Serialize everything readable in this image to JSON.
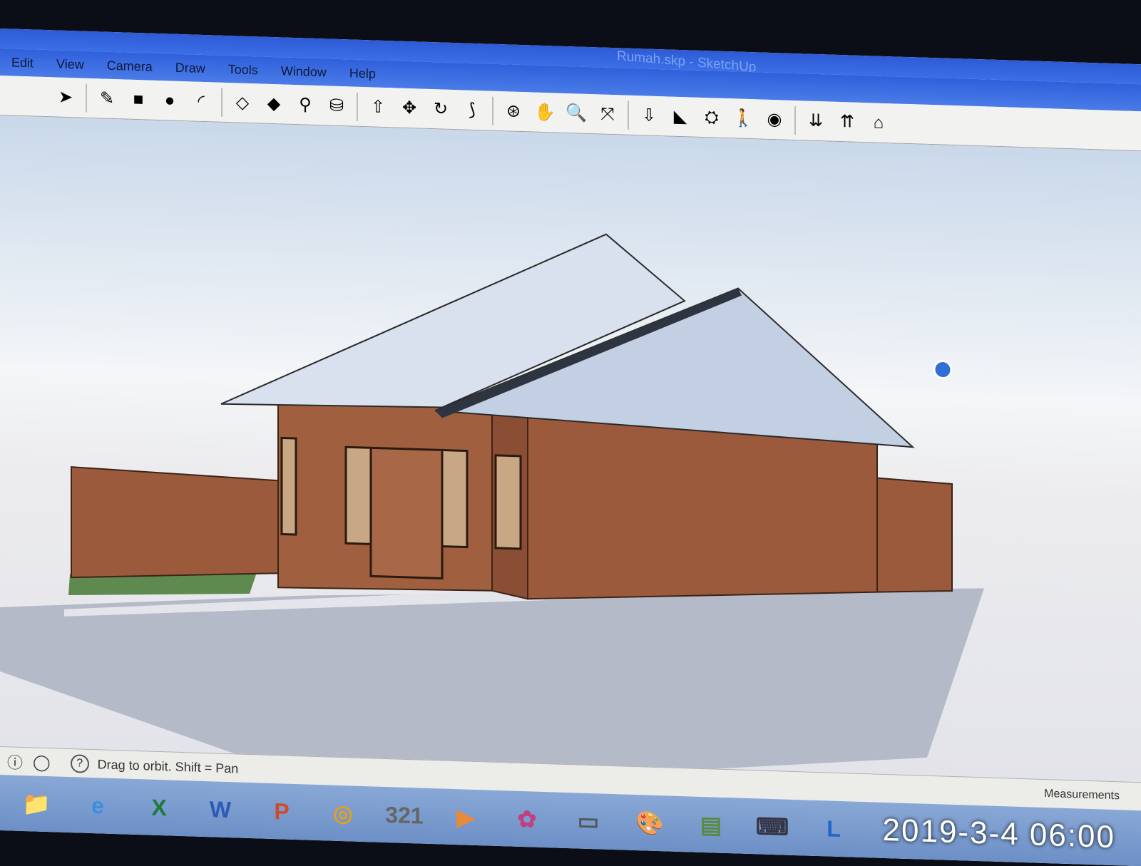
{
  "window": {
    "title": "Rumah.skp - SketchUp"
  },
  "menu": {
    "items": [
      {
        "label": "Edit"
      },
      {
        "label": "View"
      },
      {
        "label": "Camera"
      },
      {
        "label": "Draw"
      },
      {
        "label": "Tools"
      },
      {
        "label": "Window"
      },
      {
        "label": "Help"
      }
    ]
  },
  "toolbar": {
    "tools": [
      {
        "name": "select-tool",
        "icon": "arrow-icon",
        "glyph": "➤"
      },
      {
        "name": "pencil-tool",
        "icon": "pencil-icon",
        "glyph": "✎"
      },
      {
        "name": "rectangle-tool",
        "icon": "rectangle-icon",
        "glyph": "■"
      },
      {
        "name": "circle-tool",
        "icon": "circle-icon",
        "glyph": "●"
      },
      {
        "name": "arc-tool",
        "icon": "arc-icon",
        "glyph": "◜"
      },
      {
        "name": "make-component-tool",
        "icon": "component-icon",
        "glyph": "◇"
      },
      {
        "name": "eraser-tool",
        "icon": "eraser-icon",
        "glyph": "◆"
      },
      {
        "name": "tape-measure-tool",
        "icon": "tape-icon",
        "glyph": "⚲"
      },
      {
        "name": "paint-bucket-tool",
        "icon": "bucket-icon",
        "glyph": "⛁"
      },
      {
        "name": "push-pull-tool",
        "icon": "pushpull-icon",
        "glyph": "⇧"
      },
      {
        "name": "move-tool",
        "icon": "move-icon",
        "glyph": "✥"
      },
      {
        "name": "rotate-tool",
        "icon": "rotate-icon",
        "glyph": "↻"
      },
      {
        "name": "offset-tool",
        "icon": "offset-icon",
        "glyph": "⟆"
      },
      {
        "name": "orbit-tool",
        "icon": "orbit-icon",
        "glyph": "⊛"
      },
      {
        "name": "pan-tool",
        "icon": "hand-icon",
        "glyph": "✋"
      },
      {
        "name": "zoom-tool",
        "icon": "magnifier-icon",
        "glyph": "🔍"
      },
      {
        "name": "zoom-extents-tool",
        "icon": "zoom-extents-icon",
        "glyph": "⤧"
      },
      {
        "name": "previous-view-tool",
        "icon": "previous-icon",
        "glyph": "⇩"
      },
      {
        "name": "next-view-tool",
        "icon": "next-icon",
        "glyph": "◣"
      },
      {
        "name": "position-camera-tool",
        "icon": "camera-icon",
        "glyph": "⛭"
      },
      {
        "name": "walk-tool",
        "icon": "walk-icon",
        "glyph": "🚶"
      },
      {
        "name": "look-around-tool",
        "icon": "eye-icon",
        "glyph": "◉"
      },
      {
        "name": "get-models-tool",
        "icon": "warehouse-icon",
        "glyph": "⇊"
      },
      {
        "name": "share-model-tool",
        "icon": "share-icon",
        "glyph": "⇈"
      },
      {
        "name": "extension-warehouse-tool",
        "icon": "extension-icon",
        "glyph": "⌂"
      }
    ]
  },
  "status": {
    "hint": "Drag to orbit.  Shift = Pan",
    "measurements_label": "Measurements"
  },
  "taskbar": {
    "apps": [
      {
        "name": "explorer",
        "icon": "folder-icon",
        "glyph": "📁",
        "color": "#e2b23a"
      },
      {
        "name": "internet-explorer",
        "icon": "ie-icon",
        "glyph": "e",
        "color": "#3a8fe0"
      },
      {
        "name": "excel",
        "icon": "excel-icon",
        "glyph": "X",
        "color": "#1f7a3a"
      },
      {
        "name": "word",
        "icon": "word-icon",
        "glyph": "W",
        "color": "#2b5ab8"
      },
      {
        "name": "powerpoint",
        "icon": "powerpoint-icon",
        "glyph": "P",
        "color": "#d04b2a"
      },
      {
        "name": "chrome",
        "icon": "chrome-icon",
        "glyph": "◎",
        "color": "#e0a020"
      },
      {
        "name": "calendar",
        "icon": "calendar-icon",
        "glyph": "321",
        "color": "#666"
      },
      {
        "name": "media-player",
        "icon": "media-icon",
        "glyph": "▶",
        "color": "#e88a3a"
      },
      {
        "name": "flower-app",
        "icon": "flower-icon",
        "glyph": "✿",
        "color": "#c04080"
      },
      {
        "name": "viewer-app",
        "icon": "viewer-icon",
        "glyph": "▭",
        "color": "#555"
      },
      {
        "name": "paint-app",
        "icon": "palette-icon",
        "glyph": "🎨",
        "color": "#b07030"
      },
      {
        "name": "notes-app",
        "icon": "notes-icon",
        "glyph": "▤",
        "color": "#5a8a40"
      },
      {
        "name": "keyboard-app",
        "icon": "keyboard-icon",
        "glyph": "⌨",
        "color": "#334"
      },
      {
        "name": "sketchup-app",
        "icon": "sketchup-icon",
        "glyph": "L",
        "color": "#2266cc"
      }
    ],
    "clock": "2019-3-4 06:00"
  },
  "colors": {
    "brick": "#9b5a3c",
    "roof": "#c3cfe2",
    "shadow": "#b4bac8",
    "ground": "#e4e5eb"
  }
}
